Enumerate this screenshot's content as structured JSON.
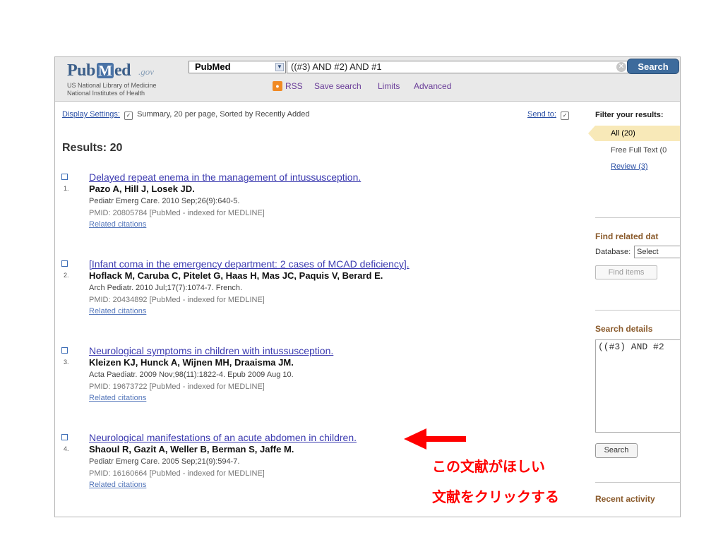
{
  "header": {
    "logo": {
      "pub": "Pub",
      "m": "M",
      "ed": "ed",
      "gov": ".gov",
      "line1": "US National Library of Medicine",
      "line2": "National Institutes of Health"
    },
    "database_selected": "PubMed",
    "query": "((#3) AND #2) AND #1",
    "search_label": "Search",
    "toolbar": {
      "rss": "RSS",
      "save_search": "Save search",
      "limits": "Limits",
      "advanced": "Advanced"
    }
  },
  "display": {
    "settings_label": "Display Settings:",
    "settings_value": "Summary, 20 per page, Sorted by Recently Added",
    "send_to": "Send to:"
  },
  "results_title": "Results: 20",
  "results": [
    {
      "num": "1.",
      "title": "Delayed repeat enema in the management of intussusception.",
      "authors": "Pazo A, Hill J, Losek JD.",
      "journal": "Pediatr Emerg Care. 2010 Sep;26(9):640-5.",
      "pmid": "PMID: 20805784 [PubMed - indexed for MEDLINE]",
      "related": "Related citations"
    },
    {
      "num": "2.",
      "title": "[Infant coma in the emergency department: 2 cases of MCAD deficiency].",
      "authors": "Hoflack M, Caruba C, Pitelet G, Haas H, Mas JC, Paquis V, Berard E.",
      "journal": "Arch Pediatr. 2010 Jul;17(7):1074-7. French.",
      "pmid": "PMID: 20434892 [PubMed - indexed for MEDLINE]",
      "related": "Related citations"
    },
    {
      "num": "3.",
      "title": "Neurological symptoms in children with intussusception.",
      "authors": "Kleizen KJ, Hunck A, Wijnen MH, Draaisma JM.",
      "journal": "Acta Paediatr. 2009 Nov;98(11):1822-4. Epub 2009 Aug 10.",
      "pmid": "PMID: 19673722 [PubMed - indexed for MEDLINE]",
      "related": "Related citations"
    },
    {
      "num": "4.",
      "title": "Neurological manifestations of an acute abdomen in children.",
      "authors": "Shaoul R, Gazit A, Weller B, Berman S, Jaffe M.",
      "journal": "Pediatr Emerg Care. 2005 Sep;21(9):594-7.",
      "pmid": "PMID: 16160664 [PubMed - indexed for MEDLINE]",
      "related": "Related citations"
    }
  ],
  "sidebar": {
    "filter_heading": "Filter your results:",
    "all": "All (20)",
    "free_full_text": "Free Full Text (0",
    "review": "Review (3)",
    "find_related_heading": "Find related dat",
    "database_label": "Database:",
    "database_select": "Select",
    "find_items": "Find items",
    "search_details_heading": "Search details",
    "search_details_text": "((#3) AND #2",
    "search_button": "Search",
    "recent_activity_heading": "Recent activity"
  },
  "annotation": {
    "line1": "この文献がほしい",
    "line2": "文献をクリックする",
    "color": "#ff0000"
  }
}
